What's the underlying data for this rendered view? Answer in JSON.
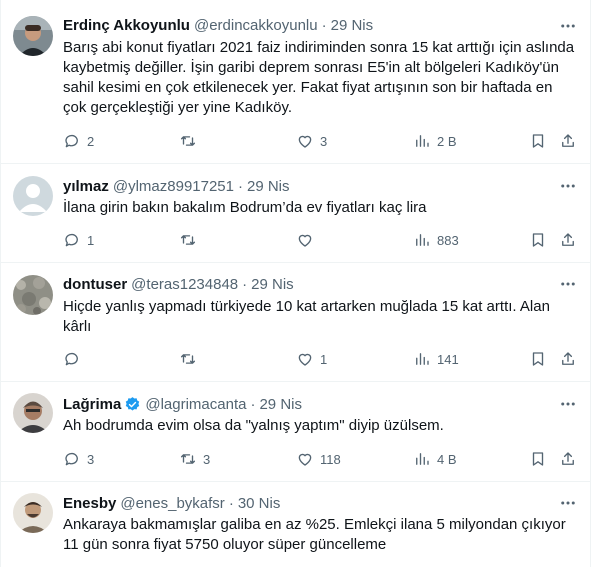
{
  "icons": {
    "reply": "reply-icon",
    "retweet": "retweet-icon",
    "like": "like-icon",
    "views": "views-icon",
    "bookmark": "bookmark-icon",
    "share": "share-icon",
    "more": "more-icon",
    "verified": "verified-badge-icon"
  },
  "colors": {
    "text_secondary": "#536471",
    "verified_blue": "#1d9bf0",
    "divider": "#eff3f4"
  },
  "tweets": [
    {
      "name": "Erdinç Akkoyunlu",
      "handle": "@erdincakkoyunlu",
      "separator": "·",
      "time": "29 Nis",
      "text": "Barış abi konut fiyatları 2021 faiz indiriminden sonra  15 kat arttığı için aslında kaybetmiş değiller. İşin garibi deprem sonrası E5'in alt bölgeleri Kadıköy'ün sahil kesimi en çok etkilenecek yer. Fakat fiyat artışının son bir haftada en çok gerçekleştiği yer yine Kadıköy.",
      "replies": "2",
      "retweets": "",
      "likes": "3",
      "views": "2 B"
    },
    {
      "name": "yılmaz",
      "handle": "@ylmaz89917251",
      "separator": "·",
      "time": "29 Nis",
      "text": "İlana girin bakın bakalım Bodrum’da ev fiyatları kaç lira",
      "replies": "1",
      "retweets": "",
      "likes": "",
      "views": "883"
    },
    {
      "name": "dontuser",
      "handle": "@teras1234848",
      "separator": "·",
      "time": "29 Nis",
      "text": "Hiçde yanlış yapmadı türkiyede 10 kat artarken muğlada 15 kat arttı. Alan kârlı",
      "replies": "",
      "retweets": "",
      "likes": "1",
      "views": "141"
    },
    {
      "name": "Lağrima",
      "handle": "@lagrimacanta",
      "separator": "·",
      "time": "29 Nis",
      "text": "Ah bodrumda evim olsa da \"yalnış yaptım\" diyip üzülsem.",
      "replies": "3",
      "retweets": "3",
      "likes": "118",
      "views": "4 B"
    },
    {
      "name": "Enesby",
      "handle": "@enes_bykafsr",
      "separator": "·",
      "time": "30 Nis",
      "text": "Ankaraya bakmamışlar galiba en az %25. Emlekçi ilana 5 milyondan çıkıyor 11 gün sonra fiyat 5750 oluyor süper güncelleme",
      "replies": "",
      "retweets": "",
      "likes": "",
      "views": ""
    }
  ]
}
